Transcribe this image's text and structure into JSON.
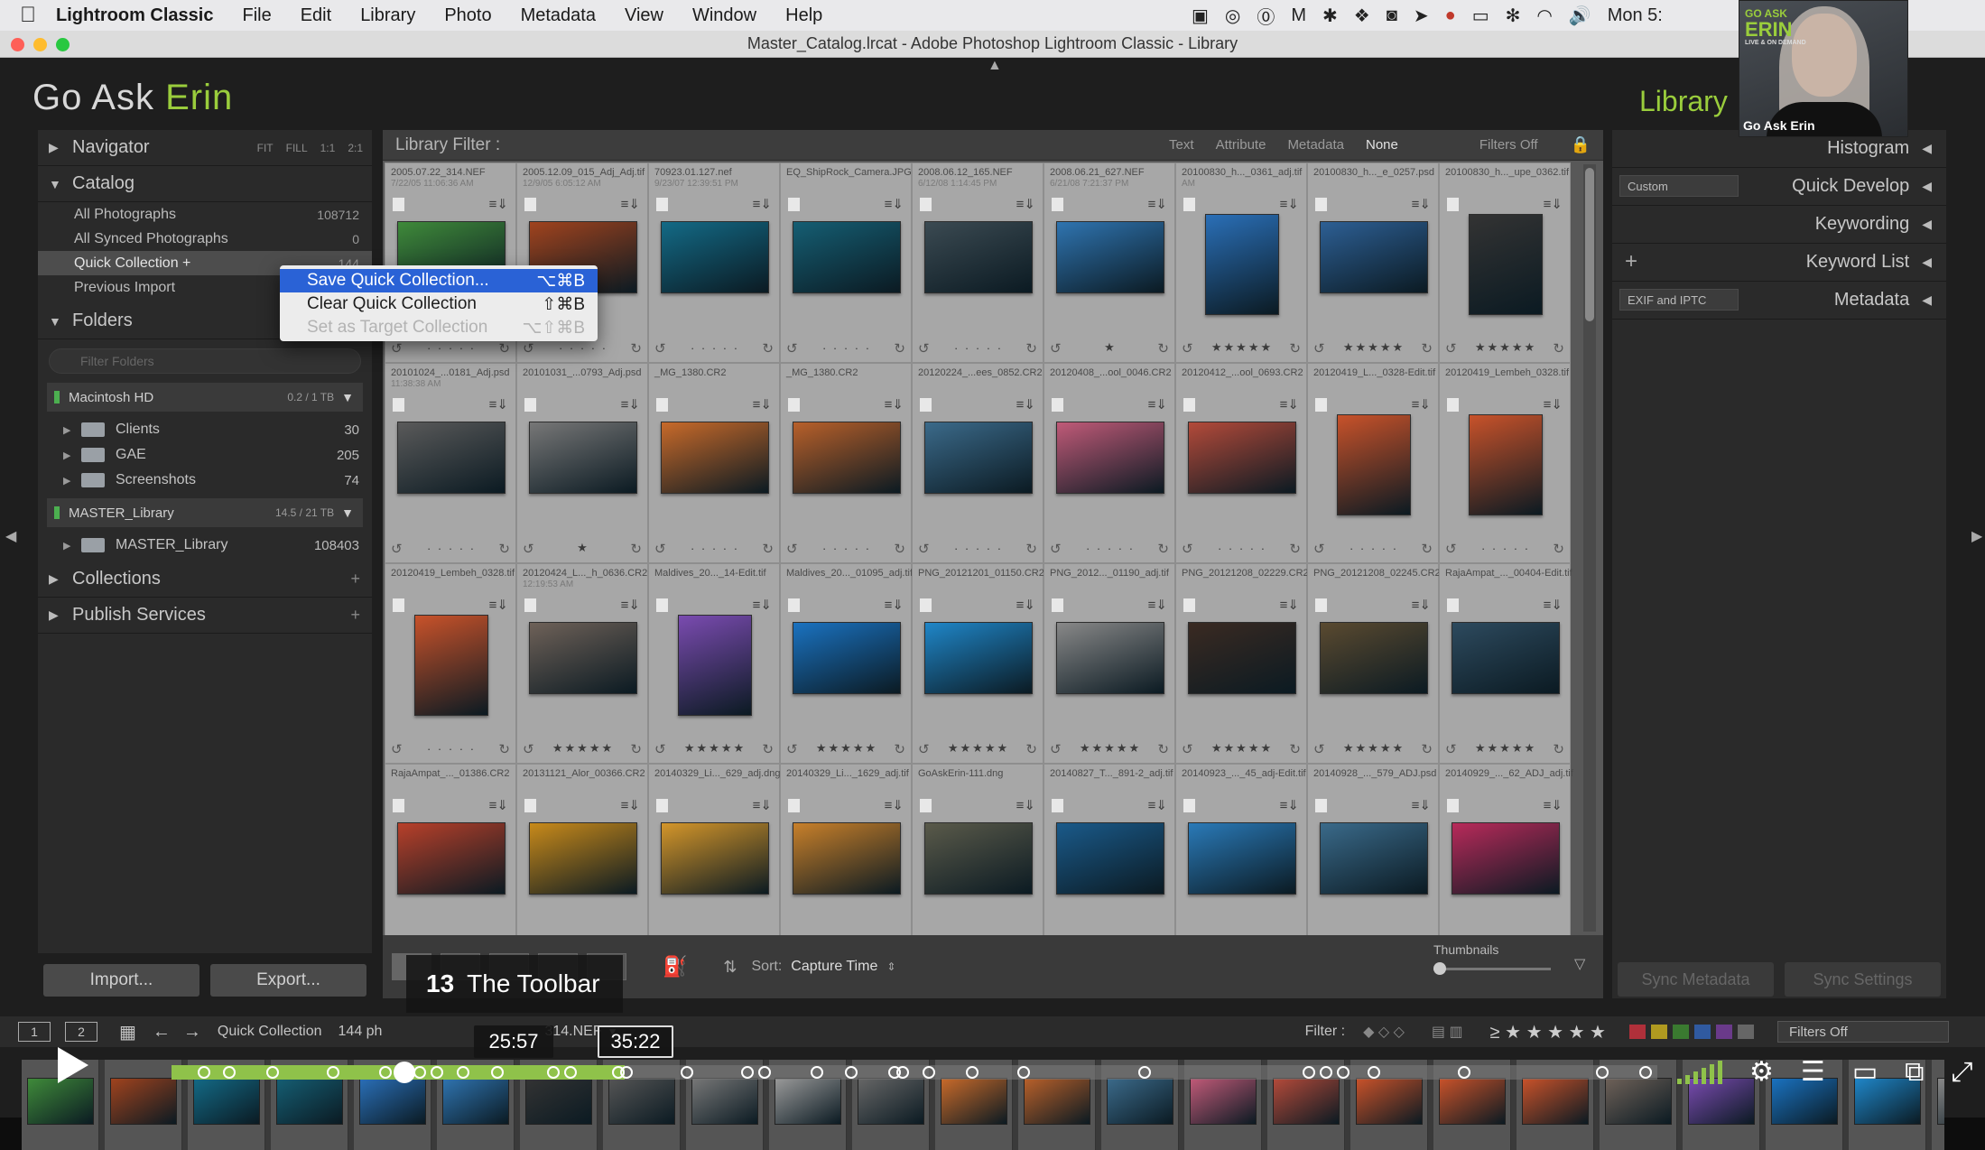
{
  "menubar": {
    "app": "Lightroom Classic",
    "items": [
      "File",
      "Edit",
      "Library",
      "Photo",
      "Metadata",
      "View",
      "Window",
      "Help"
    ],
    "clock": "Mon 5:"
  },
  "window": {
    "title": "Master_Catalog.lrcat - Adobe Photoshop Lightroom Classic - Library"
  },
  "identity": {
    "brand": "Go Ask ",
    "brand_accent": "Erin",
    "module": "Library"
  },
  "webcam": {
    "logo_line1": "GO ASK",
    "logo_line2": "ERIN",
    "logo_line3": "LIVE & ON DEMAND",
    "caption": "Go Ask Erin"
  },
  "navigator": {
    "title": "Navigator",
    "zoom": [
      "FIT",
      "FILL",
      "1:1",
      "2:1"
    ]
  },
  "catalog": {
    "title": "Catalog",
    "items": [
      {
        "label": "All Photographs",
        "count": "108712"
      },
      {
        "label": "All Synced Photographs",
        "count": "0"
      },
      {
        "label": "Quick Collection  +",
        "count": "144"
      },
      {
        "label": "Previous Import",
        "count": ""
      }
    ]
  },
  "folders": {
    "title": "Folders",
    "search_placeholder": "Filter Folders",
    "volumes": [
      {
        "name": "Macintosh HD",
        "cap": "0.2 / 1 TB",
        "children": [
          {
            "label": "Clients",
            "count": "30"
          },
          {
            "label": "GAE",
            "count": "205"
          },
          {
            "label": "Screenshots",
            "count": "74"
          }
        ]
      },
      {
        "name": "MASTER_Library",
        "cap": "14.5 / 21 TB",
        "children": [
          {
            "label": "MASTER_Library",
            "count": "108403"
          }
        ]
      }
    ]
  },
  "collections": {
    "title": "Collections"
  },
  "publish": {
    "title": "Publish Services"
  },
  "left_buttons": {
    "import": "Import...",
    "export": "Export..."
  },
  "context_menu": {
    "items": [
      {
        "label": "Save Quick Collection...",
        "shortcut": "⌥⌘B",
        "state": "highlighted"
      },
      {
        "label": "Clear Quick Collection",
        "shortcut": "⇧⌘B",
        "state": "normal"
      },
      {
        "label": "Set as Target Collection",
        "shortcut": "⌥⇧⌘B",
        "state": "disabled"
      }
    ]
  },
  "filterbar": {
    "title": "Library Filter :",
    "options": [
      "Text",
      "Attribute",
      "Metadata",
      "None"
    ],
    "active": "None",
    "status": "Filters Off"
  },
  "grid": {
    "rows": [
      [
        {
          "name": "2005.07.22_314.NEF",
          "date": "7/22/05 11:06:36 AM",
          "stars": "",
          "color": "#3f8a3a"
        },
        {
          "name": "2005.12.09_015_Adj_Adj.tif",
          "date": "12/9/05 6:05:12 AM",
          "stars": "",
          "color": "#a0431e"
        },
        {
          "name": "70923.01.127.nef",
          "date": "9/23/07 12:39:51 PM",
          "stars": "",
          "color": "#136a86"
        },
        {
          "name": "EQ_ShipRock_Camera.JPG",
          "date": "",
          "stars": "",
          "color": "#155e73"
        },
        {
          "name": "2008.06.12_165.NEF",
          "date": "6/12/08 1:14:45 PM",
          "stars": "",
          "color": "#3b4a52"
        },
        {
          "name": "2008.06.21_627.NEF",
          "date": "6/21/08 7:21:37 PM",
          "stars": "★",
          "color": "#2f74b0"
        },
        {
          "name": "20100830_h..._0361_adj.tif",
          "date": "AM",
          "stars": "★★★★★",
          "color": "#2a6fb7"
        },
        {
          "name": "20100830_h..._e_0257.psd",
          "date": "",
          "stars": "★★★★★",
          "color": "#2d5f94"
        },
        {
          "name": "20100830_h..._upe_0362.tif",
          "date": "",
          "stars": "★★★★★",
          "color": "#333"
        }
      ],
      [
        {
          "name": "20101024_...0181_Adj.psd",
          "date": "11:38:38 AM",
          "stars": "",
          "color": "#5a5a5a"
        },
        {
          "name": "20101031_...0793_Adj.psd",
          "date": "",
          "stars": "★",
          "color": "#777"
        },
        {
          "name": "_MG_1380.CR2",
          "date": "",
          "stars": "",
          "color": "#c86a2a"
        },
        {
          "name": "_MG_1380.CR2",
          "date": "",
          "stars": "",
          "color": "#b8602a"
        },
        {
          "name": "20120224_...ees_0852.CR2",
          "date": "",
          "stars": "",
          "color": "#3b6a8a"
        },
        {
          "name": "20120408_...ool_0046.CR2",
          "date": "",
          "stars": "",
          "color": "#c05a78"
        },
        {
          "name": "20120412_...ool_0693.CR2",
          "date": "",
          "stars": "",
          "color": "#b34a3a"
        },
        {
          "name": "20120419_L..._0328-Edit.tif",
          "date": "",
          "stars": "",
          "color": "#c8522a"
        },
        {
          "name": "20120419_Lembeh_0328.tif",
          "date": "",
          "stars": "",
          "color": "#c8522a"
        }
      ],
      [
        {
          "name": "20120419_Lembeh_0328.tif",
          "date": "",
          "stars": "",
          "color": "#c8522a"
        },
        {
          "name": "20120424_L..._h_0636.CR2",
          "date": "12:19:53 AM",
          "stars": "★★★★★",
          "color": "#6e6158"
        },
        {
          "name": "Maldives_20..._14-Edit.tif",
          "date": "",
          "stars": "★★★★★",
          "color": "#7a4bb0"
        },
        {
          "name": "Maldives_20..._01095_adj.tif",
          "date": "",
          "stars": "★★★★★",
          "color": "#1a72c0"
        },
        {
          "name": "PNG_20121201_01150.CR2",
          "date": "",
          "stars": "★★★★★",
          "color": "#1f86c8"
        },
        {
          "name": "PNG_2012..._01190_adj.tif",
          "date": "",
          "stars": "★★★★★",
          "color": "#888"
        },
        {
          "name": "PNG_20121208_02229.CR2",
          "date": "",
          "stars": "★★★★★",
          "color": "#3a2a22"
        },
        {
          "name": "PNG_20121208_02245.CR2",
          "date": "",
          "stars": "★★★★★",
          "color": "#5a4a30"
        },
        {
          "name": "RajaAmpat_..._00404-Edit.tif",
          "date": "",
          "stars": "★★★★★",
          "color": "#2d4a5e"
        }
      ],
      [
        {
          "name": "RajaAmpat_..._01386.CR2",
          "date": "",
          "stars": "",
          "color": "#b8402a"
        },
        {
          "name": "20131121_Alor_00366.CR2",
          "date": "",
          "stars": "",
          "color": "#c88a1a"
        },
        {
          "name": "20140329_Li..._629_adj.dng",
          "date": "",
          "stars": "",
          "color": "#d4962a"
        },
        {
          "name": "20140329_Li..._1629_adj.tif",
          "date": "",
          "stars": "",
          "color": "#c8802a"
        },
        {
          "name": "GoAskErin-111.dng",
          "date": "",
          "stars": "",
          "color": "#5a5a4a"
        },
        {
          "name": "20140827_T..._891-2_adj.tif",
          "date": "",
          "stars": "",
          "color": "#1a5a8a"
        },
        {
          "name": "20140923_..._45_adj-Edit.tif",
          "date": "",
          "stars": "",
          "color": "#2a7ab8"
        },
        {
          "name": "20140928_..._579_ADJ.psd",
          "date": "",
          "stars": "",
          "color": "#3a6a8a"
        },
        {
          "name": "20140929_..._62_ADJ_adj.tif",
          "date": "",
          "stars": "",
          "color": "#b82a5a"
        }
      ]
    ]
  },
  "toolbar": {
    "sort_label": "Sort:",
    "sort_value": "Capture Time",
    "thumbs_label": "Thumbnails"
  },
  "rightpanel": {
    "items": [
      {
        "label": "Histogram",
        "select": ""
      },
      {
        "label": "Quick Develop",
        "select": "Custom"
      },
      {
        "label": "Keywording",
        "select": ""
      },
      {
        "label": "Keyword List",
        "select": ""
      },
      {
        "label": "Metadata",
        "select": "EXIF and IPTC"
      }
    ],
    "sync_metadata": "Sync Metadata",
    "sync_settings": "Sync Settings"
  },
  "filmstrip_bar": {
    "pages": [
      "1",
      "2"
    ],
    "source": "Quick Collection",
    "count_text": "144 ph",
    "file": "314.NEF",
    "filter_label": "Filter :",
    "filter_value": "Filters Off"
  },
  "video": {
    "chapter_num": "13",
    "chapter_title": "The Toolbar",
    "hover_time": "25:57",
    "duration": "35:22",
    "progress": 0.305
  }
}
